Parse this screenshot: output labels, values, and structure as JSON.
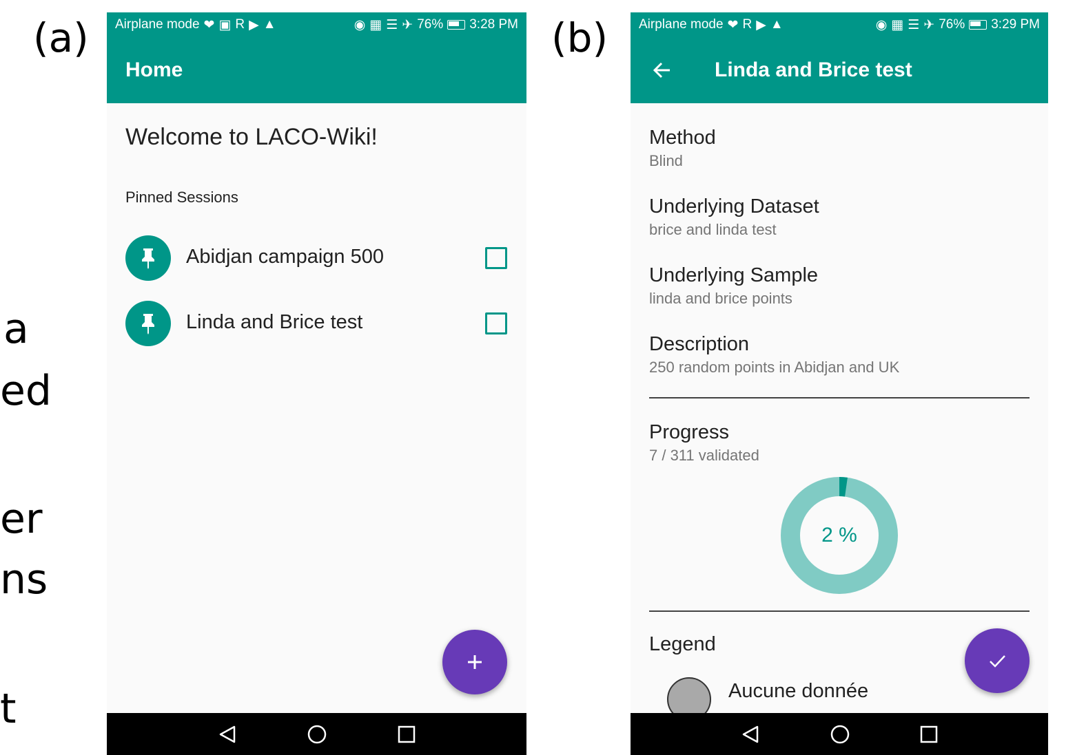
{
  "figure": {
    "label_a": "(a)",
    "label_b": "(b)",
    "background_fragments": [
      "a",
      "ed",
      "er",
      "ns",
      "t"
    ]
  },
  "colors": {
    "primary": "#009688",
    "accent": "#673ab7",
    "donut_track": "#80cbc4",
    "legend_swatch": "#a9a9a9"
  },
  "phone_a": {
    "status": {
      "left": "Airplane mode",
      "battery": "76%",
      "time": "3:28 PM"
    },
    "appbar_title": "Home",
    "welcome": "Welcome to LACO-Wiki!",
    "pinned_header": "Pinned Sessions",
    "sessions": [
      {
        "label": "Abidjan campaign 500",
        "checked": false
      },
      {
        "label": "Linda and Brice test",
        "checked": false
      }
    ],
    "fab_icon": "plus-icon"
  },
  "phone_b": {
    "status": {
      "left": "Airplane mode",
      "battery": "76%",
      "time": "3:29 PM"
    },
    "appbar_title": "Linda and Brice test",
    "fields": [
      {
        "label": "Method",
        "value": "Blind"
      },
      {
        "label": "Underlying Dataset",
        "value": "brice and linda test"
      },
      {
        "label": "Underlying Sample",
        "value": "linda and brice points"
      },
      {
        "label": "Description",
        "value": "250 random points in Abidjan and UK"
      }
    ],
    "progress": {
      "label": "Progress",
      "value": "7 / 311 validated",
      "percent_text": "2 %",
      "fraction": 0.0225
    },
    "legend": {
      "title": "Legend",
      "items": [
        {
          "label": "Aucune donnée"
        }
      ]
    },
    "fab_icon": "check-icon"
  },
  "navbar": {
    "icons": [
      "back-triangle-icon",
      "home-circle-icon",
      "recents-square-icon"
    ]
  }
}
